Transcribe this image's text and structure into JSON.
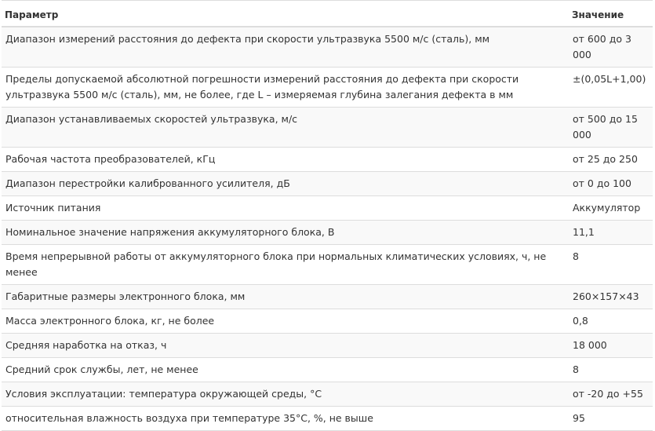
{
  "table": {
    "headers": {
      "param": "Параметр",
      "value": "Значение"
    },
    "rows": [
      {
        "param": "Диапазон измерений расстояния до дефекта при скорости ультразвука 5500 м/с (сталь), мм",
        "value": "от 600 до 3 000"
      },
      {
        "param": "Пределы допускаемой абсолютной погрешности измерений расстояния до дефекта при скорости ультразвука 5500 м/с (сталь), мм, не более, где L – измеряемая глубина залегания дефекта в мм",
        "value": "±(0,05L+1,00)"
      },
      {
        "param": "Диапазон устанавливаемых скоростей ультразвука, м/с",
        "value": "от 500 до 15 000"
      },
      {
        "param": "Рабочая частота преобразователей, кГц",
        "value": "от 25 до 250"
      },
      {
        "param": "Диапазон перестройки калиброванного усилителя, дБ",
        "value": "от 0 до 100"
      },
      {
        "param": "Источник питания",
        "value": "Аккумулятор"
      },
      {
        "param": "Номинальное значение напряжения аккумуляторного блока, В",
        "value": "11,1"
      },
      {
        "param": "Время непрерывной работы от аккумуляторного блока при нормальных климатических условиях, ч, не менее",
        "value": "8"
      },
      {
        "param": "Габаритные размеры электронного блока, мм",
        "value": "260×157×43"
      },
      {
        "param": "Масса электронного блока, кг, не более",
        "value": "0,8"
      },
      {
        "param": "Средняя наработка на отказ, ч",
        "value": "18 000"
      },
      {
        "param": "Средний срок службы, лет, не менее",
        "value": "8"
      },
      {
        "param": "Условия эксплуатации: температура окружающей среды, °С",
        "value": "от -20 до +55"
      },
      {
        "param": "относительная влажность воздуха при температуре 35°С, %, не выше",
        "value": "95"
      }
    ]
  }
}
